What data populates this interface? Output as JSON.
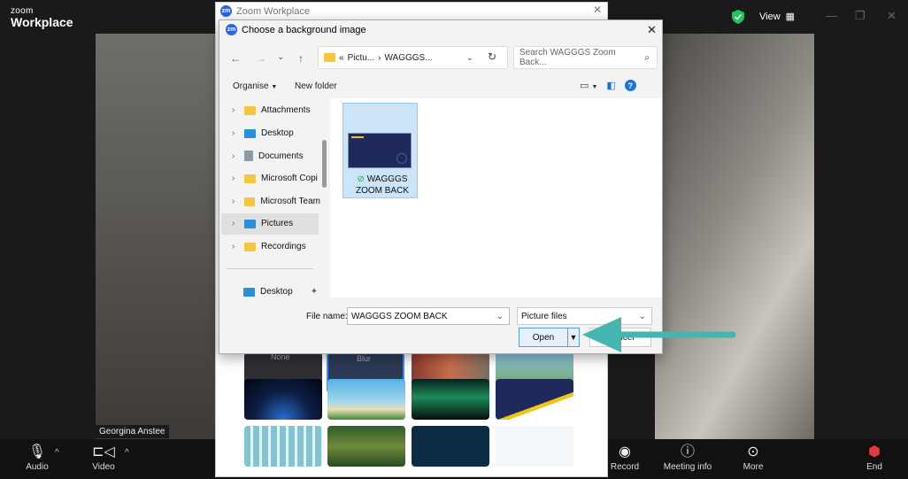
{
  "zoom": {
    "brand_small": "zoom",
    "brand_big": "Workplace",
    "view_label": "View",
    "participant_name": "Georgina Anstee"
  },
  "toolbar": {
    "audio": "Audio",
    "video": "Video",
    "record": "Record",
    "meeting_info": "Meeting info",
    "more": "More",
    "end": "End"
  },
  "picker": {
    "title": "Zoom Workplace",
    "row1": [
      "None",
      "Blur"
    ]
  },
  "dialog": {
    "title": "Choose a background image",
    "address": [
      "«",
      "Pictu...",
      "›",
      "WAGGGS..."
    ],
    "search_placeholder": "Search WAGGGS Zoom Back...",
    "organise": "Organise",
    "new_folder": "New folder",
    "nav_items": [
      "Attachments",
      "Desktop",
      "Documents",
      "Microsoft Copi",
      "Microsoft Team",
      "Pictures",
      "Recordings"
    ],
    "quick_access": "Desktop",
    "file": {
      "name_line1": "WAGGGS",
      "name_line2": "ZOOM BACK"
    },
    "filename_label": "File name:",
    "filename_value": "WAGGGS ZOOM BACK",
    "file_type": "Picture files",
    "open": "Open",
    "cancel": "Cancel"
  },
  "colors": {
    "accent_blue": "#1f73d6",
    "arrow_teal": "#45b5b0",
    "folder_yellow": "#f4c542",
    "zoom_blue": "#2d62ea"
  }
}
